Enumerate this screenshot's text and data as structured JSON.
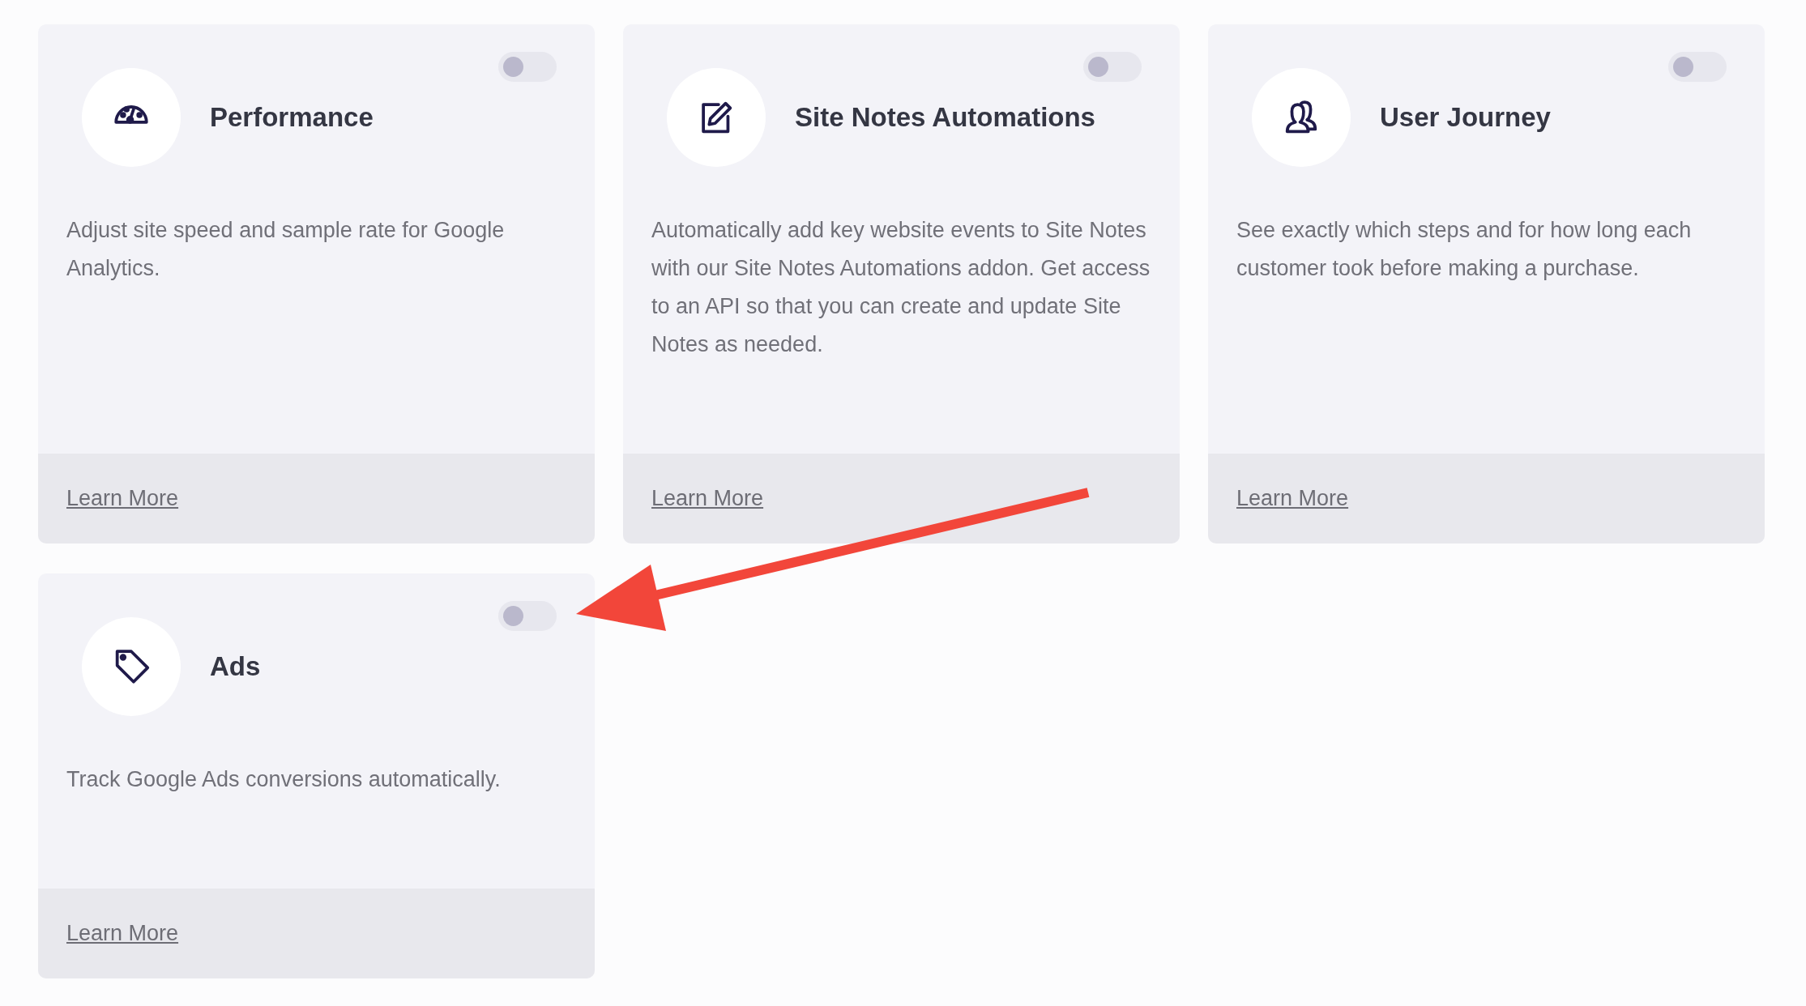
{
  "cards": [
    {
      "kind": "gauge",
      "title": "Performance",
      "description": "Adjust site speed and sample rate for Google Analytics.",
      "link": "Learn More",
      "on": false
    },
    {
      "kind": "note",
      "title": "Site Notes Automations",
      "description": "Automatically add key website events to Site Notes with our Site Notes Automations addon. Get access to an API so that you can create and update Site Notes as needed.",
      "link": "Learn More",
      "on": false
    },
    {
      "kind": "users",
      "title": "User Journey",
      "description": "See exactly which steps and for how long each customer took before making a purchase.",
      "link": "Learn More",
      "on": false
    },
    {
      "kind": "tag",
      "title": "Ads",
      "description": "Track Google Ads conversions automatically.",
      "link": "Learn More",
      "on": false
    }
  ]
}
